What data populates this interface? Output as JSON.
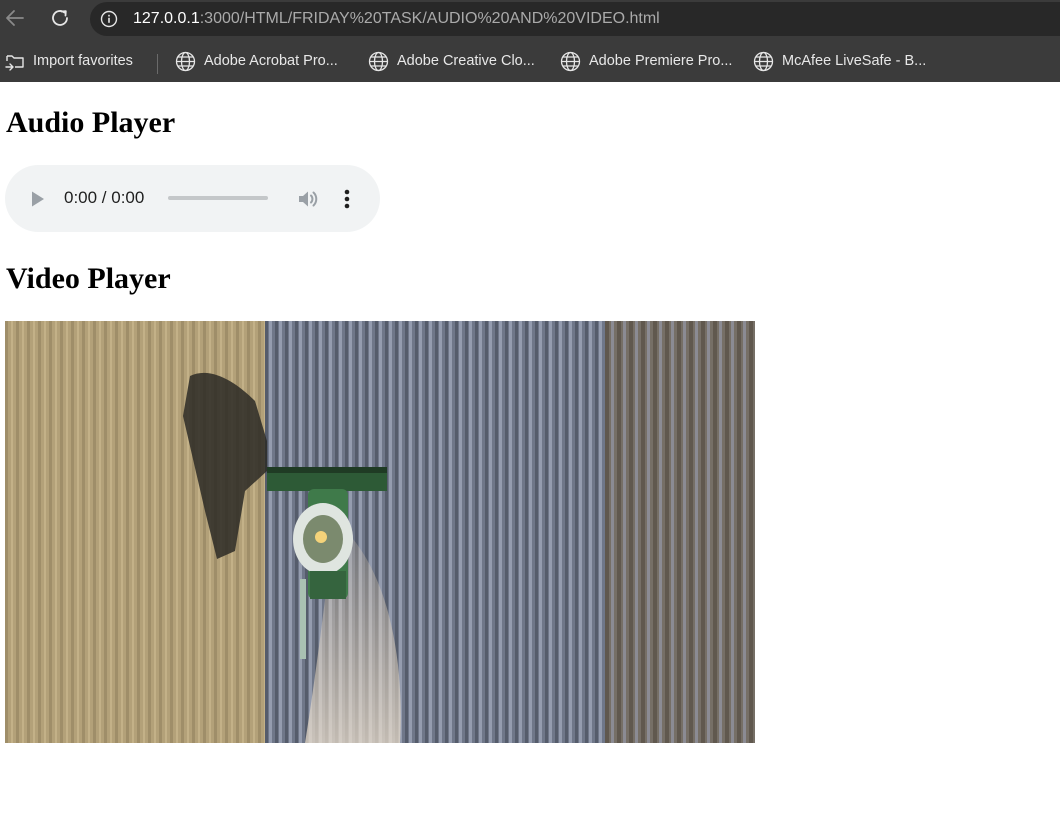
{
  "browser": {
    "address": {
      "host": "127.0.0.1",
      "path": ":3000/HTML/FRIDAY%20TASK/AUDIO%20AND%20VIDEO.html"
    },
    "bookmarks": [
      {
        "label": "Import favorites",
        "icon": "import-favorites-icon"
      },
      {
        "label": "Adobe Acrobat Pro...",
        "icon": "globe-icon"
      },
      {
        "label": "Adobe Creative Clo...",
        "icon": "globe-icon"
      },
      {
        "label": "Adobe Premiere Pro...",
        "icon": "globe-icon"
      },
      {
        "label": "McAfee LiveSafe - B...",
        "icon": "globe-icon"
      }
    ]
  },
  "page": {
    "audio_heading": "Audio Player",
    "video_heading": "Video Player",
    "audio_player": {
      "time": "0:00 / 0:00",
      "progress": 0
    },
    "video_player": {
      "poster_subject": "aerial view of a combine harvester in a crop field"
    }
  },
  "colors": {
    "chrome_bg": "#3b3b3b",
    "address_bg": "#282828",
    "player_bg": "#f1f3f4"
  }
}
